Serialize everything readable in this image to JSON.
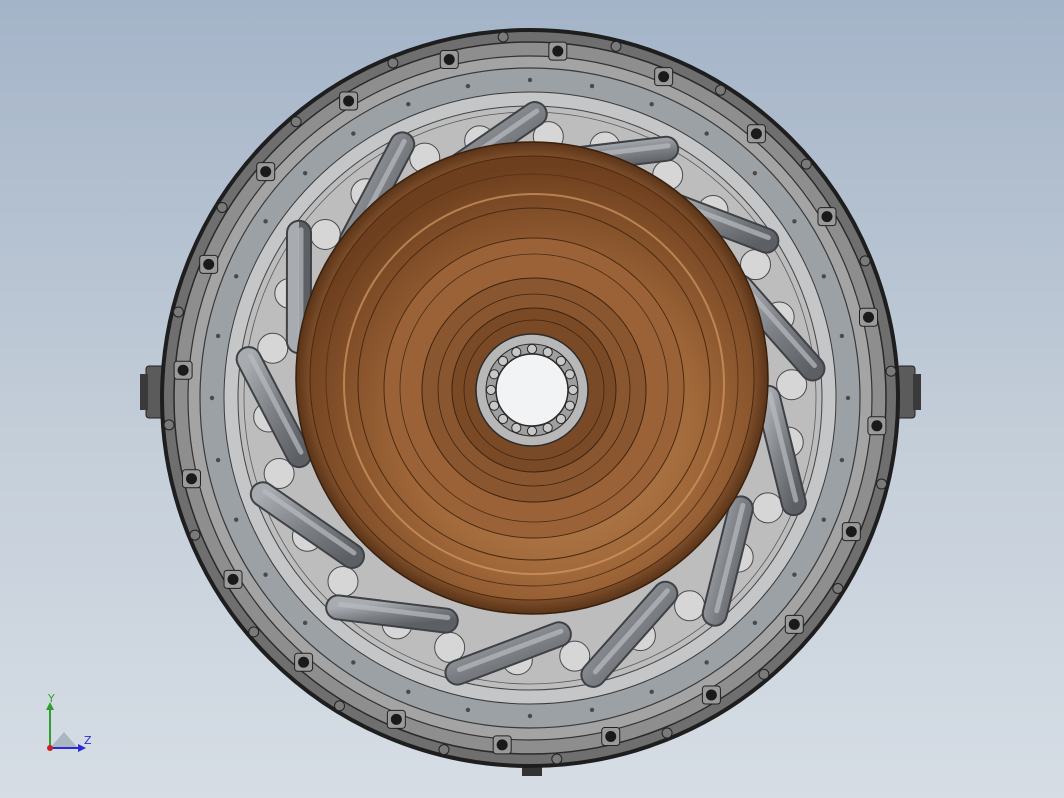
{
  "viewport": {
    "background_top": "#a4b4c8",
    "background_bottom": "#d6dde5"
  },
  "model": {
    "outer_housing_color": "#8c8c8c",
    "inner_plate_color": "#b9b9b9",
    "flange_ring_color": "#9aa0a4",
    "tube_color": "#8b8e92",
    "bolt_color": "#1a1a1a",
    "hub_color": "#9b6233",
    "hub_highlight": "#c28a52",
    "bearing_color": "#c8c8c8",
    "bolt_count": 20,
    "tube_count": 13
  },
  "triad": {
    "y_label": "Y",
    "z_label": "Z",
    "y_axis_color": "#2e9e2e",
    "z_axis_color": "#2a2ad6",
    "origin_color": "#c82020"
  }
}
